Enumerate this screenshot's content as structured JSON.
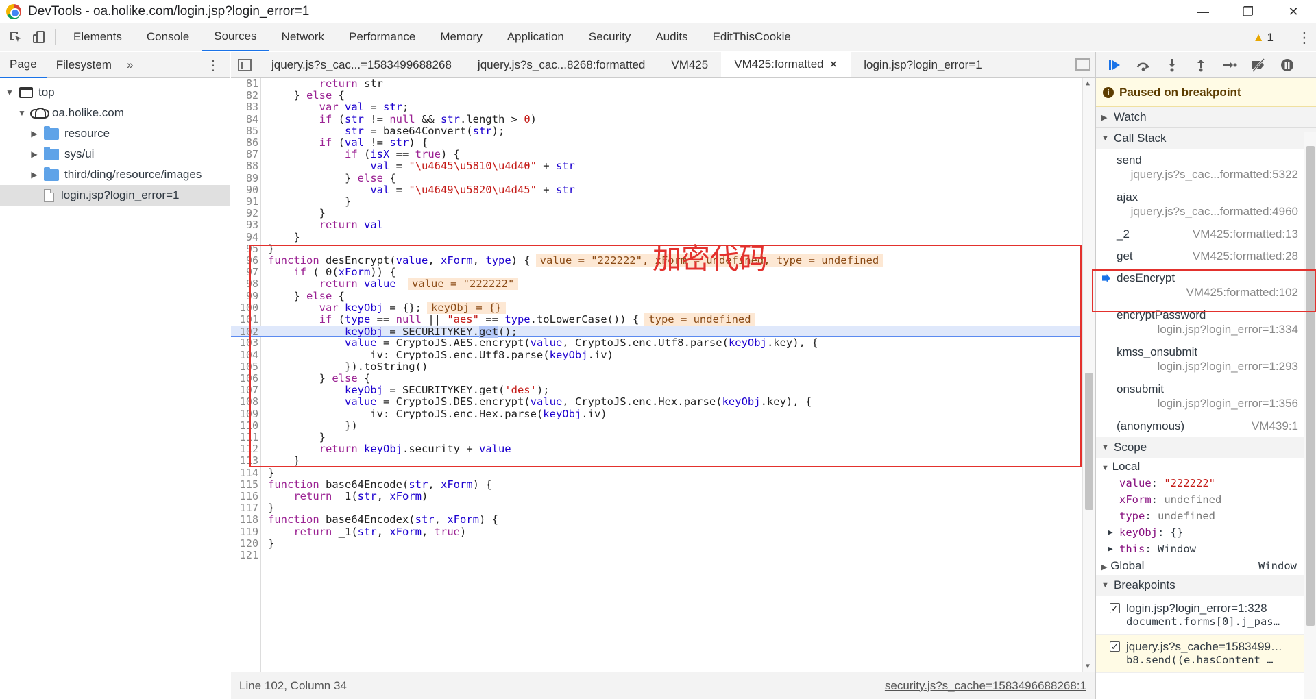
{
  "window": {
    "title": "DevTools - oa.holike.com/login.jsp?login_error=1",
    "minimize": "—",
    "maximize": "❐",
    "close": "✕"
  },
  "toolbar": {
    "tabs": [
      "Elements",
      "Console",
      "Sources",
      "Network",
      "Performance",
      "Memory",
      "Application",
      "Security",
      "Audits",
      "EditThisCookie"
    ],
    "active_tab": "Sources",
    "warning_count": "1"
  },
  "navigator": {
    "tabs": [
      "Page",
      "Filesystem"
    ],
    "more": "»",
    "tree": [
      {
        "label": "top",
        "depth": 0,
        "kind": "frame",
        "expanded": true
      },
      {
        "label": "oa.holike.com",
        "depth": 1,
        "kind": "cloud",
        "expanded": true
      },
      {
        "label": "resource",
        "depth": 2,
        "kind": "folder",
        "expanded": false
      },
      {
        "label": "sys/ui",
        "depth": 2,
        "kind": "folder",
        "expanded": false
      },
      {
        "label": "third/ding/resource/images",
        "depth": 2,
        "kind": "folder",
        "expanded": false
      },
      {
        "label": "login.jsp?login_error=1",
        "depth": 2,
        "kind": "file",
        "selected": true
      }
    ]
  },
  "editor": {
    "tabs": [
      "jquery.js?s_cac...=1583499688268",
      "jquery.js?s_cac...8268:formatted",
      "VM425",
      "VM425:formatted",
      "login.jsp?login_error=1"
    ],
    "active_tab": "VM425:formatted",
    "annotation": "加密代码",
    "status_position": "Line 102, Column 34",
    "status_link": "security.js?s_cache=1583496688268:1",
    "lines": [
      {
        "n": "81",
        "html": "        <span class='kw'>return</span> str"
      },
      {
        "n": "82",
        "html": "    } <span class='kw'>else</span> {"
      },
      {
        "n": "83",
        "html": "        <span class='kw'>var</span> <span class='var'>val</span> = <span class='var'>str</span>;"
      },
      {
        "n": "84",
        "html": "        <span class='kw'>if</span> (<span class='var'>str</span> != <span class='kw'>null</span> &amp;&amp; <span class='var'>str</span>.length &gt; <span class='str'>0</span>)"
      },
      {
        "n": "85",
        "html": "            <span class='var'>str</span> = base64Convert(<span class='var'>str</span>);"
      },
      {
        "n": "86",
        "html": "        <span class='kw'>if</span> (<span class='var'>val</span> != <span class='var'>str</span>) {"
      },
      {
        "n": "87",
        "html": "            <span class='kw'>if</span> (<span class='var'>isX</span> == <span class='kw'>true</span>) {"
      },
      {
        "n": "88",
        "html": "                <span class='var'>val</span> = <span class='str'>\"\\u4645\\u5810\\u4d40\"</span> + <span class='var'>str</span>"
      },
      {
        "n": "89",
        "html": "            } <span class='kw'>else</span> {"
      },
      {
        "n": "90",
        "html": "                <span class='var'>val</span> = <span class='str'>\"\\u4649\\u5820\\u4d45\"</span> + <span class='var'>str</span>"
      },
      {
        "n": "91",
        "html": "            }"
      },
      {
        "n": "92",
        "html": "        }"
      },
      {
        "n": "93",
        "html": "        <span class='kw'>return</span> <span class='var'>val</span>"
      },
      {
        "n": "94",
        "html": "    }"
      },
      {
        "n": "95",
        "html": "}"
      },
      {
        "n": "96",
        "html": "<span class='kw'>function</span> desEncrypt(<span class='var'>value</span>, <span class='var'>xForm</span>, <span class='var'>type</span>) {<span class='inline-val'>value = \"222222\", xForm = undefined, type = undefined</span>"
      },
      {
        "n": "97",
        "html": "    <span class='kw'>if</span> (_0(<span class='var'>xForm</span>)) {"
      },
      {
        "n": "98",
        "html": "        <span class='kw'>return</span> <span class='var'>value</span> <span class='inline-val'>value = \"222222\"</span>"
      },
      {
        "n": "99",
        "html": "    } <span class='kw'>else</span> {"
      },
      {
        "n": "100",
        "html": "        <span class='kw'>var</span> <span class='var'>keyObj</span> = {};<span class='inline-val'>keyObj = {}</span>"
      },
      {
        "n": "101",
        "html": "        <span class='kw'>if</span> (<span class='var'>type</span> == <span class='kw'>null</span> || <span class='str'>\"aes\"</span> == <span class='var'>type</span>.toLowerCase()) {<span class='inline-val'>type = undefined</span>"
      },
      {
        "n": "102",
        "html": "            <span class='var'>keyObj</span> = SECURITYKEY.<span class='get-sel'>get</span>();",
        "current": true
      },
      {
        "n": "103",
        "html": "            <span class='var'>value</span> = CryptoJS.AES.encrypt(<span class='var'>value</span>, CryptoJS.enc.Utf8.parse(<span class='var'>keyObj</span>.key), {"
      },
      {
        "n": "104",
        "html": "                iv: CryptoJS.enc.Utf8.parse(<span class='var'>keyObj</span>.iv)"
      },
      {
        "n": "105",
        "html": "            }).toString()"
      },
      {
        "n": "106",
        "html": "        } <span class='kw'>else</span> {"
      },
      {
        "n": "107",
        "html": "            <span class='var'>keyObj</span> = SECURITYKEY.get(<span class='str'>'des'</span>);"
      },
      {
        "n": "108",
        "html": "            <span class='var'>value</span> = CryptoJS.DES.encrypt(<span class='var'>value</span>, CryptoJS.enc.Hex.parse(<span class='var'>keyObj</span>.key), {"
      },
      {
        "n": "109",
        "html": "                iv: CryptoJS.enc.Hex.parse(<span class='var'>keyObj</span>.iv)"
      },
      {
        "n": "110",
        "html": "            })"
      },
      {
        "n": "111",
        "html": "        }"
      },
      {
        "n": "112",
        "html": "        <span class='kw'>return</span> <span class='var'>keyObj</span>.security + <span class='var'>value</span>"
      },
      {
        "n": "113",
        "html": "    }"
      },
      {
        "n": "114",
        "html": "}"
      },
      {
        "n": "115",
        "html": "<span class='kw'>function</span> base64Encode(<span class='var'>str</span>, <span class='var'>xForm</span>) {"
      },
      {
        "n": "116",
        "html": "    <span class='kw'>return</span> _1(<span class='var'>str</span>, <span class='var'>xForm</span>)"
      },
      {
        "n": "117",
        "html": "}"
      },
      {
        "n": "118",
        "html": "<span class='kw'>function</span> base64Encodex(<span class='var'>str</span>, <span class='var'>xForm</span>) {"
      },
      {
        "n": "119",
        "html": "    <span class='kw'>return</span> _1(<span class='var'>str</span>, <span class='var'>xForm</span>, <span class='kw'>true</span>)"
      },
      {
        "n": "120",
        "html": "}"
      },
      {
        "n": "121",
        "html": ""
      }
    ]
  },
  "debugger": {
    "paused": "Paused on breakpoint",
    "watch": "Watch",
    "call_stack": "Call Stack",
    "frames": [
      {
        "name": "send",
        "loc": "jquery.js?s_cac...formatted:5322",
        "two_line": true
      },
      {
        "name": "ajax",
        "loc": "jquery.js?s_cac...formatted:4960",
        "two_line": true
      },
      {
        "name": "_2",
        "loc": "VM425:formatted:13",
        "two_line": false
      },
      {
        "name": "get",
        "loc": "VM425:formatted:28",
        "two_line": false
      },
      {
        "name": "desEncrypt",
        "loc": "VM425:formatted:102",
        "two_line": true,
        "current": true
      },
      {
        "name": "encryptPassword",
        "loc": "login.jsp?login_error=1:334",
        "two_line": true
      },
      {
        "name": "kmss_onsubmit",
        "loc": "login.jsp?login_error=1:293",
        "two_line": true
      },
      {
        "name": "onsubmit",
        "loc": "login.jsp?login_error=1:356",
        "two_line": true
      },
      {
        "name": "(anonymous)",
        "loc": "VM439:1",
        "two_line": false
      }
    ],
    "scope": "Scope",
    "local": "Local",
    "local_vars": [
      {
        "key": "value",
        "val": "\"222222\"",
        "kind": "str"
      },
      {
        "key": "xForm",
        "val": "undefined",
        "kind": "und"
      },
      {
        "key": "type",
        "val": "undefined",
        "kind": "und"
      },
      {
        "key": "keyObj",
        "val": "{}",
        "kind": "obj",
        "expandable": true
      },
      {
        "key": "this",
        "val": "Window",
        "kind": "obj",
        "expandable": true
      }
    ],
    "global": "Global",
    "global_val": "Window",
    "breakpoints": "Breakpoints",
    "bps": [
      {
        "file": "login.jsp?login_error=1:328",
        "code": "document.forms[0].j_pas…"
      },
      {
        "file": "jquery.js?s_cache=1583499…",
        "code": "b8.send((e.hasContent …",
        "active": true
      }
    ]
  }
}
